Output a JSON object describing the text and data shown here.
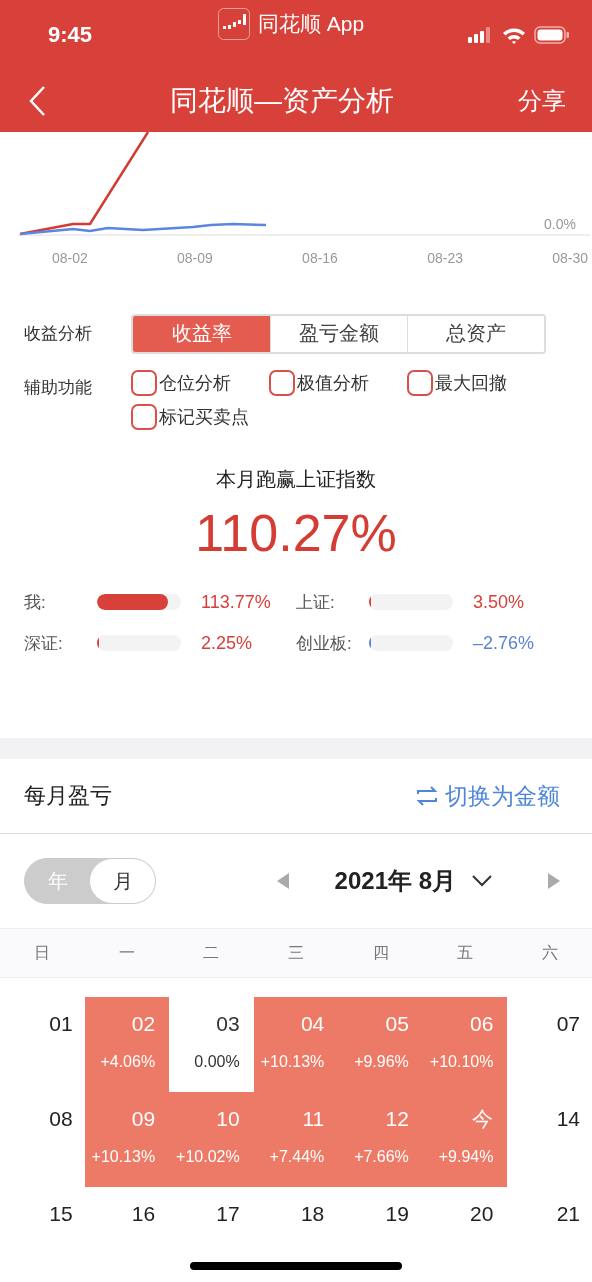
{
  "status_bar": {
    "time": "9:45",
    "app_name": "同花顺 App"
  },
  "nav": {
    "title": "同花顺—资产分析",
    "action": "分享"
  },
  "chart": {
    "x_labels": [
      "08-02",
      "08-09",
      "08-16",
      "08-23",
      "08-30"
    ],
    "zero_label": "0.0%"
  },
  "analysis": {
    "label": "收益分析",
    "tabs": [
      {
        "label": "收益率",
        "selected": true
      },
      {
        "label": "盈亏金额",
        "selected": false
      },
      {
        "label": "总资产",
        "selected": false
      }
    ]
  },
  "aux": {
    "label": "辅助功能",
    "options": [
      {
        "label": "仓位分析",
        "checked": false
      },
      {
        "label": "极值分析",
        "checked": false
      },
      {
        "label": "最大回撤",
        "checked": false
      },
      {
        "label": "标记买卖点",
        "checked": false
      }
    ]
  },
  "summary": {
    "title": "本月跑赢上证指数",
    "value": "110.27%"
  },
  "comparison": [
    {
      "name": "我:",
      "level": 0.85,
      "value": "113.77%",
      "color": "#d8403a"
    },
    {
      "name": "上证:",
      "level": 0.02,
      "value": "3.50%",
      "color": "#d8403a"
    },
    {
      "name": "深证:",
      "level": 0.015,
      "value": "2.25%",
      "color": "#d8403a"
    },
    {
      "name": "创业板:",
      "level": 0.015,
      "value": "–2.76%",
      "color": "#5a83d6"
    }
  ],
  "monthly": {
    "title": "每月盈亏",
    "switch_label": "切换为金额"
  },
  "period_toggle": [
    {
      "label": "年",
      "selected": false
    },
    {
      "label": "月",
      "selected": true
    }
  ],
  "month_label": "2021年 8月",
  "weekdays": [
    "日",
    "一",
    "二",
    "三",
    "四",
    "五",
    "六"
  ],
  "calendar": [
    [
      {
        "day": "01",
        "kind": "plain"
      },
      {
        "day": "02",
        "change": "+4.06%",
        "kind": "gain"
      },
      {
        "day": "03",
        "change": "0.00%",
        "kind": "flat"
      },
      {
        "day": "04",
        "change": "+10.13%",
        "kind": "gain"
      },
      {
        "day": "05",
        "change": "+9.96%",
        "kind": "gain"
      },
      {
        "day": "06",
        "change": "+10.10%",
        "kind": "gain"
      },
      {
        "day": "07",
        "kind": "plain"
      }
    ],
    [
      {
        "day": "08",
        "kind": "plain"
      },
      {
        "day": "09",
        "change": "+10.13%",
        "kind": "gain"
      },
      {
        "day": "10",
        "change": "+10.02%",
        "kind": "gain"
      },
      {
        "day": "11",
        "change": "+7.44%",
        "kind": "gain"
      },
      {
        "day": "12",
        "change": "+7.66%",
        "kind": "gain"
      },
      {
        "day": "今",
        "change": "+9.94%",
        "kind": "gain"
      },
      {
        "day": "14",
        "kind": "plain"
      }
    ],
    [
      {
        "day": "15",
        "kind": "plain"
      },
      {
        "day": "16",
        "kind": "plain"
      },
      {
        "day": "17",
        "kind": "plain"
      },
      {
        "day": "18",
        "kind": "plain"
      },
      {
        "day": "19",
        "kind": "plain"
      },
      {
        "day": "20",
        "kind": "plain"
      },
      {
        "day": "21",
        "kind": "plain"
      }
    ]
  ]
}
